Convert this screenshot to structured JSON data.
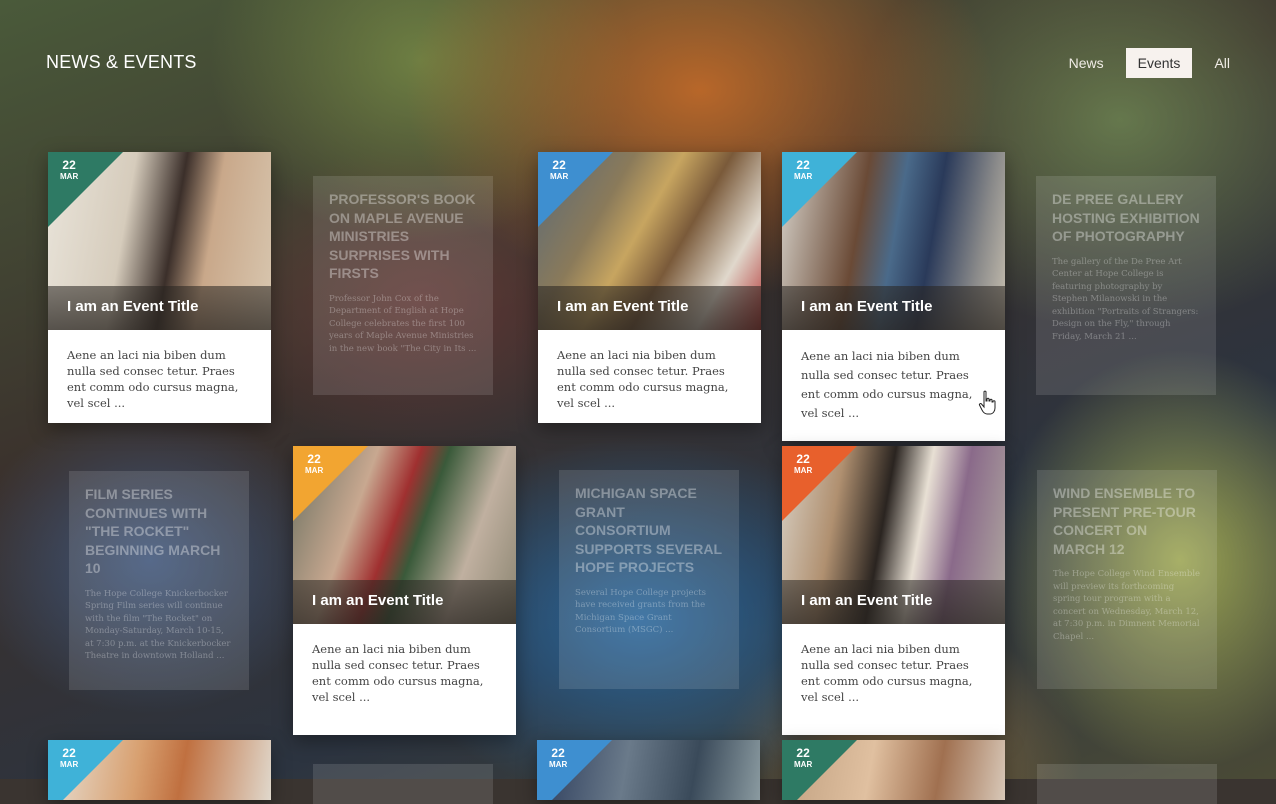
{
  "header": {
    "title": "NEWS & EVENTS"
  },
  "filters": [
    {
      "label": "News",
      "active": false
    },
    {
      "label": "Events",
      "active": true
    },
    {
      "label": "All",
      "active": false
    }
  ],
  "event_cards": [
    {
      "day": "22",
      "month": "MAR",
      "title": "I am an Event Title",
      "excerpt": "Aene an laci nia biben dum nulla sed consec tetur. Praes ent comm odo cursus magna, vel scel ...",
      "ribbon_color": "#2e7a64"
    },
    {
      "day": "22",
      "month": "MAR",
      "title": "I am an Event Title",
      "excerpt": "Aene an laci nia biben dum nulla sed consec tetur. Praes ent comm odo cursus magna, vel scel ...",
      "ribbon_color": "#3e8fd0"
    },
    {
      "day": "22",
      "month": "MAR",
      "title": "I am an Event Title",
      "excerpt": "Aene an laci nia biben dum nulla sed consec tetur. Praes ent comm odo cursus magna, vel scel ...",
      "ribbon_color": "#3fb2d8"
    },
    {
      "day": "22",
      "month": "MAR",
      "title": "I am an Event Title",
      "excerpt": "Aene an laci nia biben dum nulla sed consec tetur. Praes ent comm odo cursus magna, vel scel ...",
      "ribbon_color": "#f2a531"
    },
    {
      "day": "22",
      "month": "MAR",
      "title": "I am an Event Title",
      "excerpt": "Aene an laci nia biben dum nulla sed consec tetur. Praes ent comm odo cursus magna, vel scel ...",
      "ribbon_color": "#e8602c"
    },
    {
      "day": "22",
      "month": "MAR",
      "ribbon_color": "#3fb2d8"
    },
    {
      "day": "22",
      "month": "MAR",
      "ribbon_color": "#3e8fd0"
    },
    {
      "day": "22",
      "month": "MAR",
      "ribbon_color": "#2e7a64"
    }
  ],
  "news_cards": [
    {
      "title": "PROFESSOR'S BOOK ON MAPLE AVENUE MINISTRIES SURPRISES WITH FIRSTS",
      "excerpt": "Professor John Cox of the Department of English at Hope College celebrates the first 100 years of Maple Avenue Ministries in the new book \"The City in Its ..."
    },
    {
      "title": "DE PREE GALLERY HOSTING EXHIBITION OF PHOTOGRAPHY",
      "excerpt": "The gallery of the De Pree Art Center at Hope College is featuring photography by Stephen Milanowski in the exhibition \"Portraits of Strangers: Design on the Fly,\" through Friday, March 21 ..."
    },
    {
      "title": "FILM SERIES CONTINUES WITH \"THE ROCKET\" BEGINNING MARCH 10",
      "excerpt": "The Hope College Knickerbocker Spring Film series will continue with the film \"The Rocket\" on Monday-Saturday, March 10-15, at 7:30 p.m. at the Knickerbocker Theatre in downtown Holland ..."
    },
    {
      "title": "MICHIGAN SPACE GRANT CONSORTIUM SUPPORTS SEVERAL HOPE PROJECTS",
      "excerpt": "Several Hope College projects have received grants from the Michigan Space Grant Consortium (MSGC) ..."
    },
    {
      "title": "WIND ENSEMBLE TO PRESENT PRE-TOUR CONCERT ON MARCH 12",
      "excerpt": "The Hope College Wind Ensemble will preview its forthcoming spring tour program with a concert on Wednesday, March 12, at 7:30 p.m. in Dimnent Memorial Chapel ..."
    }
  ]
}
